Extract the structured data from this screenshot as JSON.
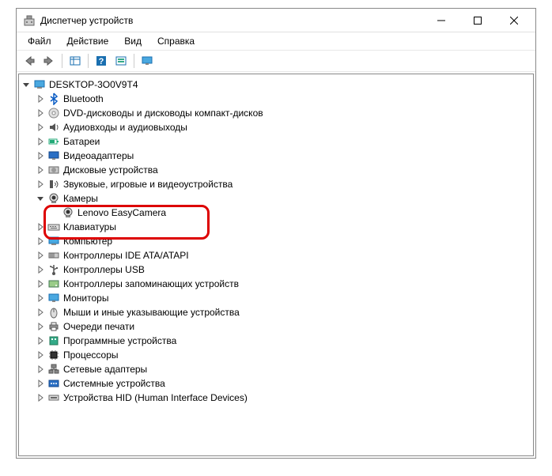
{
  "window": {
    "title": "Диспетчер устройств"
  },
  "menu": {
    "file": "Файл",
    "action": "Действие",
    "view": "Вид",
    "help": "Справка"
  },
  "tree": {
    "root": "DESKTOP-3O0V9T4",
    "items": [
      {
        "label": "Bluetooth",
        "icon": "bluetooth"
      },
      {
        "label": "DVD-дисководы и дисководы компакт-дисков",
        "icon": "disc"
      },
      {
        "label": "Аудиовходы и аудиовыходы",
        "icon": "audio"
      },
      {
        "label": "Батареи",
        "icon": "battery"
      },
      {
        "label": "Видеоадаптеры",
        "icon": "display"
      },
      {
        "label": "Дисковые устройства",
        "icon": "disk"
      },
      {
        "label": "Звуковые, игровые и видеоустройства",
        "icon": "sound"
      },
      {
        "label": "Камеры",
        "icon": "camera",
        "expanded": true,
        "children": [
          {
            "label": "Lenovo EasyCamera",
            "icon": "camera"
          }
        ]
      },
      {
        "label": "Клавиатуры",
        "icon": "keyboard"
      },
      {
        "label": "Компьютер",
        "icon": "computer"
      },
      {
        "label": "Контроллеры IDE ATA/ATAPI",
        "icon": "ide"
      },
      {
        "label": "Контроллеры USB",
        "icon": "usb"
      },
      {
        "label": "Контроллеры запоминающих устройств",
        "icon": "storage"
      },
      {
        "label": "Мониторы",
        "icon": "monitor"
      },
      {
        "label": "Мыши и иные указывающие устройства",
        "icon": "mouse"
      },
      {
        "label": "Очереди печати",
        "icon": "printer"
      },
      {
        "label": "Программные устройства",
        "icon": "software"
      },
      {
        "label": "Процессоры",
        "icon": "cpu"
      },
      {
        "label": "Сетевые адаптеры",
        "icon": "network"
      },
      {
        "label": "Системные устройства",
        "icon": "system"
      },
      {
        "label": "Устройства HID (Human Interface Devices)",
        "icon": "hid"
      }
    ]
  }
}
